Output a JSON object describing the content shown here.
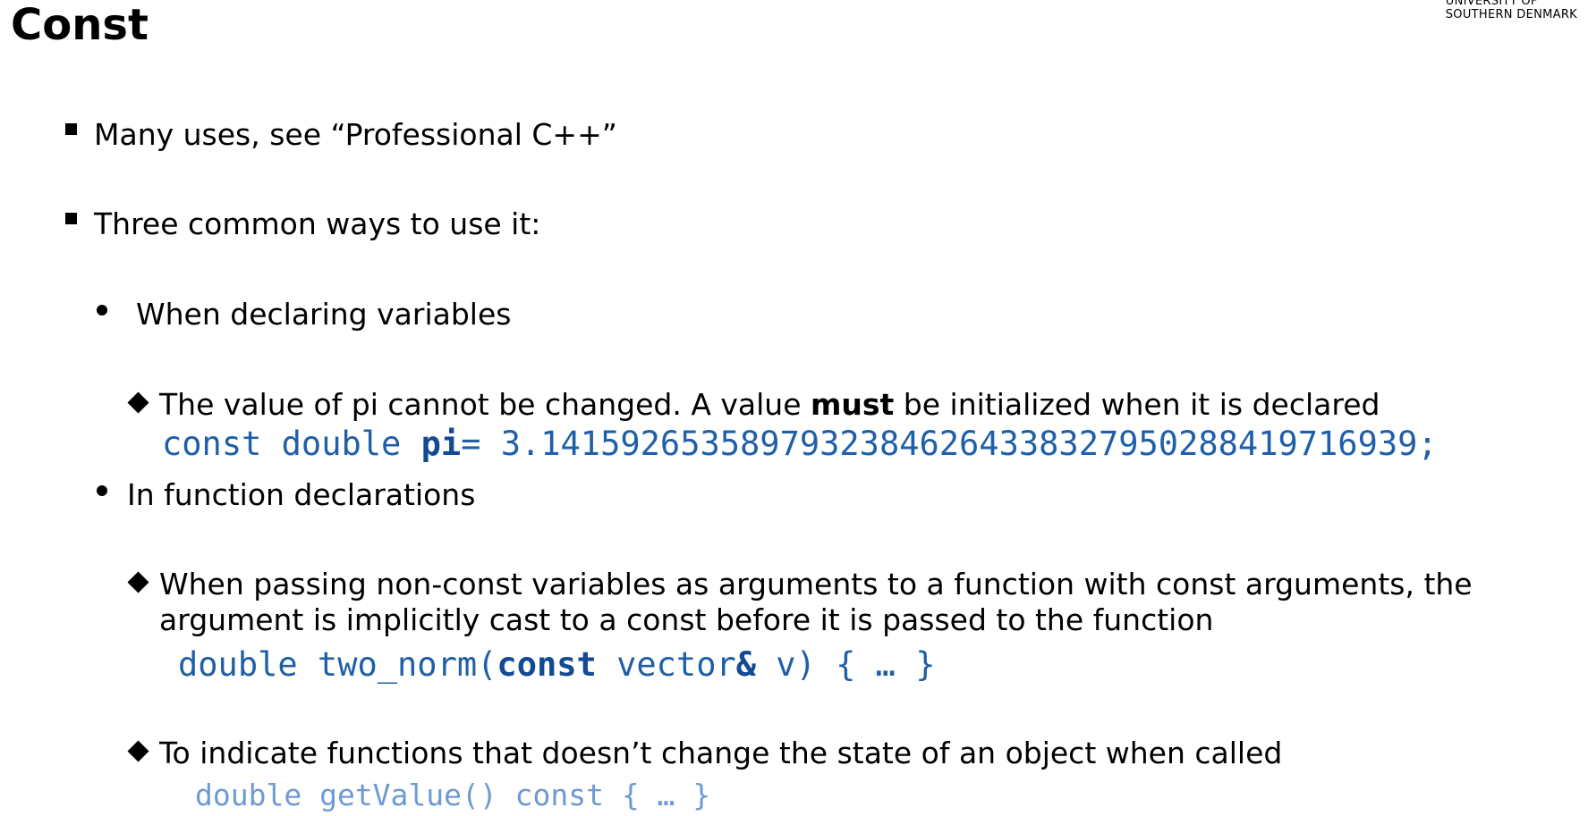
{
  "slide": {
    "title": "Const",
    "logo": {
      "line1": "UNIVERSITY OF",
      "line2": "SOUTHERN DENMARK"
    }
  },
  "bullets": {
    "b1": "Many uses, see “Professional C++”",
    "b2": "Three common ways to use it:",
    "s1": "When declaring variables",
    "s1_d1": {
      "pre": "The value of pi cannot be changed. A value ",
      "bold": "must",
      "post": " be initialized when it is declared"
    },
    "s1_code": {
      "kw": "const double ",
      "name": "pi",
      "rest": "= 3.14159265358979323846264338327950288419716939;"
    },
    "s2": "In function declarations",
    "s2_d1": {
      "line1": "When passing non-const variables as arguments to a function with const arguments, the",
      "line2": "argument is implicitly cast to a const before it is passed to the function"
    },
    "s2_code1": {
      "pre": "double two_norm(",
      "kw": "const",
      "mid": " vector",
      "amp": "&",
      "post": " v)  { … }"
    },
    "s2_d2": "To indicate functions that doesn’t change the state of an object when called",
    "s2_code2": "double getValue() const { … }"
  },
  "colors": {
    "code": "#1f5fa8",
    "code_faded": "#6e9ad4"
  }
}
